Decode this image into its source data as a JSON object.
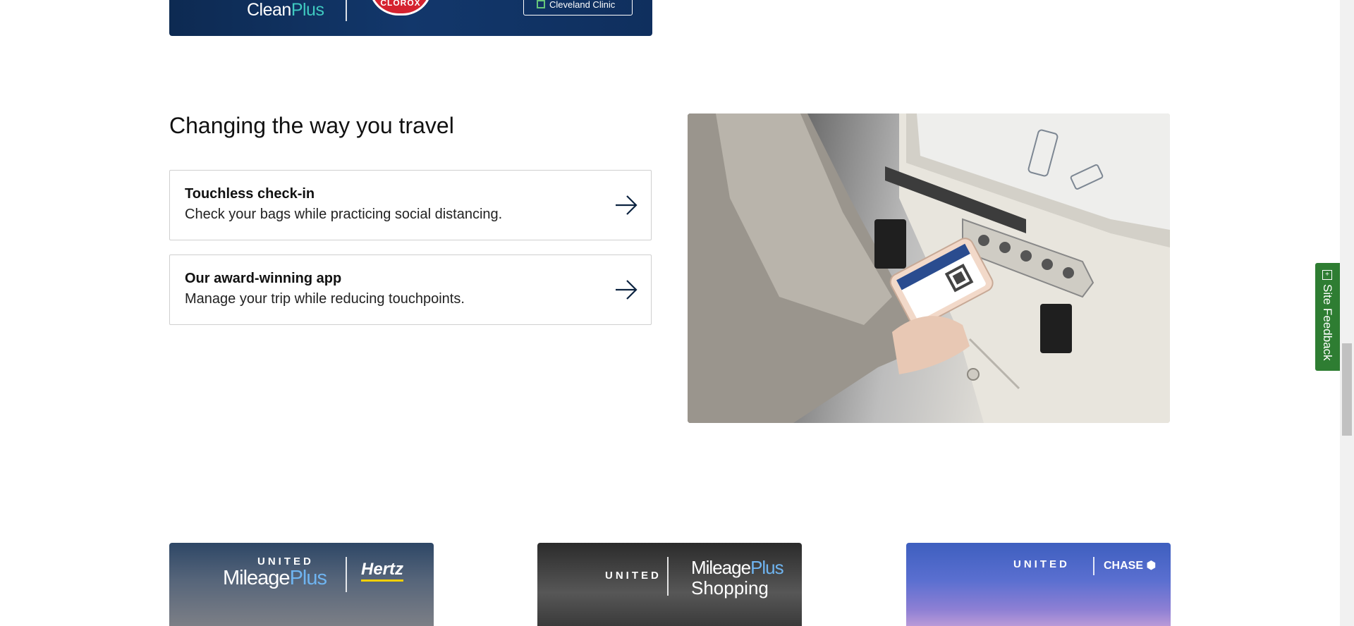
{
  "top_banner": {
    "logo_main": "Clean",
    "logo_plus": "Plus",
    "badge_text": "CLOROX",
    "clinic_label": "Cleveland Clinic"
  },
  "section": {
    "title": "Changing the way you travel",
    "cards": [
      {
        "title": "Touchless check-in",
        "description": "Check your bags while practicing social distancing.",
        "icon": "arrow-right-icon"
      },
      {
        "title": "Our award-winning app",
        "description": "Manage your trip while reducing touchpoints.",
        "icon": "arrow-right-icon"
      }
    ]
  },
  "promos": [
    {
      "brand": "UNITED",
      "program_main": "Mileage",
      "program_plus": "Plus",
      "partner": "Hertz"
    },
    {
      "brand": "UNITED",
      "program_main": "Mileage",
      "program_plus": "Plus",
      "program_sub": "Shopping"
    },
    {
      "brand": "UNITED",
      "partner": "CHASE"
    }
  ],
  "feedback": {
    "label": "Site Feedback",
    "icon_glyph": "+"
  },
  "colors": {
    "feedback_green": "#2e7d32",
    "banner_navy": "#12376b",
    "mileageplus_blue": "#6fb4f0"
  }
}
